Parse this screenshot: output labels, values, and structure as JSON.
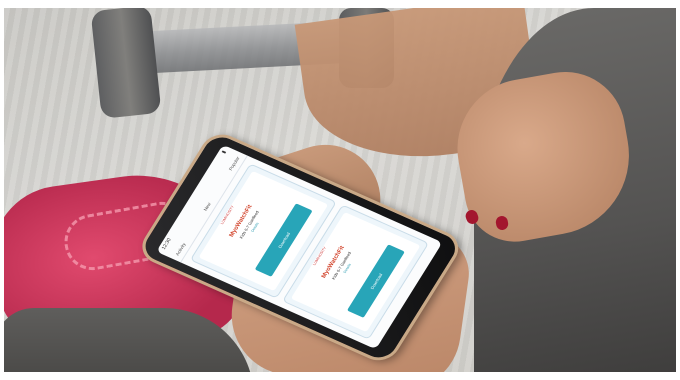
{
  "photo": {
    "description_visible": false
  },
  "phone": {
    "status_time": "12:30",
    "app_title": "Activity",
    "tab_labels": [
      "New",
      "Popular"
    ],
    "cards": [
      {
        "brand_top": "LUMINOSITY",
        "brand_name": "MyoWatchFit",
        "card_text": "Kids 6-7 Gaelfeed",
        "link_text": "Details",
        "button_label": "Download"
      },
      {
        "brand_top": "LUMINOSITY",
        "brand_name": "MyoWatchFit",
        "card_text": "Kids 6-7 Gaelfeed",
        "link_text": "Details",
        "button_label": "Download"
      }
    ]
  },
  "colors": {
    "accent": "#28a5b8",
    "brand": "#d2452d",
    "shoe": "#c8325a",
    "nail": "#a3162e"
  }
}
